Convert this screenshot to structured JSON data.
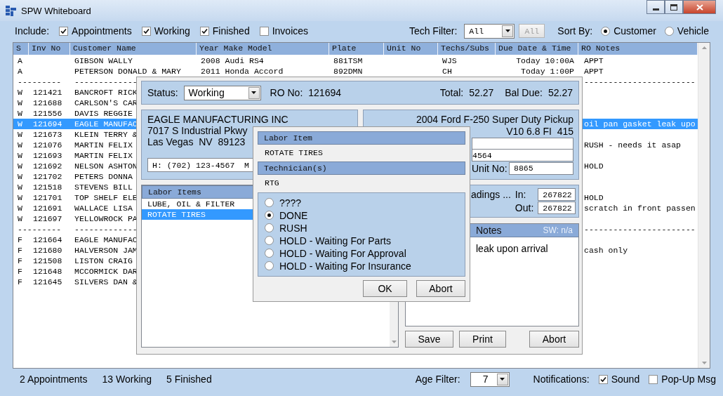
{
  "window": {
    "title": "SPW Whiteboard"
  },
  "toolbar": {
    "include_label": "Include:",
    "include": [
      {
        "label": "Appointments",
        "checked": true
      },
      {
        "label": "Working",
        "checked": true
      },
      {
        "label": "Finished",
        "checked": true
      },
      {
        "label": "Invoices",
        "checked": false
      }
    ],
    "tech_filter_label": "Tech Filter:",
    "tech_filter_value": "All",
    "tech_filter_button": {
      "label": "All",
      "disabled": true
    },
    "sort_label": "Sort By:",
    "sort_by": [
      {
        "label": "Customer",
        "selected": true
      },
      {
        "label": "Vehicle",
        "selected": false
      }
    ]
  },
  "table": {
    "columns": [
      "S",
      "Inv No",
      "Customer Name",
      "Year Make Model",
      "Plate",
      "Unit No",
      "Techs/Subs",
      "Due Date & Time",
      "RO Notes"
    ],
    "rows": [
      {
        "kind": "record",
        "selected": false,
        "s": "A",
        "customer": "GIBSON WALLY",
        "year_make_model": "2008 Audi RS4",
        "plate": "881TSM",
        "techs": "WJS",
        "due": "Today 10:00A",
        "notes": "APPT"
      },
      {
        "kind": "record",
        "selected": false,
        "s": "A",
        "customer": "PETERSON DONALD & MARY",
        "year_make_model": "2011 Honda Accord",
        "plate": "892DMN",
        "techs": "CH",
        "due": "Today 1:00P",
        "notes": "APPT"
      },
      {
        "kind": "separator",
        "selected": false,
        "s": "---------",
        "customer": "-------------",
        "notes": "-----------------------"
      },
      {
        "kind": "record",
        "selected": false,
        "s": "W",
        "inv_no": "121421",
        "customer": "BANCROFT RICK"
      },
      {
        "kind": "record",
        "selected": false,
        "s": "W",
        "inv_no": "121688",
        "customer": "CARLSON'S CAR"
      },
      {
        "kind": "record",
        "selected": false,
        "s": "W",
        "inv_no": "121556",
        "customer": "DAVIS REGGIE"
      },
      {
        "kind": "record",
        "selected": true,
        "s": "W",
        "inv_no": "121694",
        "customer": "EAGLE MANUFAC",
        "notes": "oil pan gasket leak upo"
      },
      {
        "kind": "record",
        "selected": false,
        "s": "W",
        "inv_no": "121673",
        "customer": "KLEIN TERRY &"
      },
      {
        "kind": "record",
        "selected": false,
        "s": "W",
        "inv_no": "121076",
        "customer": "MARTIN FELIX",
        "notes": "RUSH - needs it asap"
      },
      {
        "kind": "record",
        "selected": false,
        "s": "W",
        "inv_no": "121693",
        "customer": "MARTIN FELIX"
      },
      {
        "kind": "record",
        "selected": false,
        "s": "W",
        "inv_no": "121692",
        "customer": "NELSON ASHTON",
        "notes": "HOLD"
      },
      {
        "kind": "record",
        "selected": false,
        "s": "W",
        "inv_no": "121702",
        "customer": "PETERS DONNA"
      },
      {
        "kind": "record",
        "selected": false,
        "s": "W",
        "inv_no": "121518",
        "customer": "STEVENS BILL"
      },
      {
        "kind": "record",
        "selected": false,
        "s": "W",
        "inv_no": "121701",
        "customer": "TOP SHELF ELE",
        "notes": "HOLD"
      },
      {
        "kind": "record",
        "selected": false,
        "s": "W",
        "inv_no": "121691",
        "customer": "WALLACE LISA",
        "notes": "scratch in front passen"
      },
      {
        "kind": "record",
        "selected": false,
        "s": "W",
        "inv_no": "121697",
        "customer": "YELLOWROCK PA"
      },
      {
        "kind": "separator",
        "selected": false,
        "s": "---------",
        "customer": "-------------",
        "notes": "-----------------------"
      },
      {
        "kind": "record",
        "selected": false,
        "s": "F",
        "inv_no": "121664",
        "customer": "EAGLE MANUFAC"
      },
      {
        "kind": "record",
        "selected": false,
        "s": "F",
        "inv_no": "121680",
        "customer": "HALVERSON JAM",
        "notes": "cash only"
      },
      {
        "kind": "record",
        "selected": false,
        "s": "F",
        "inv_no": "121508",
        "customer": "LISTON CRAIG"
      },
      {
        "kind": "record",
        "selected": false,
        "s": "F",
        "inv_no": "121648",
        "customer": "MCCORMICK DAR"
      },
      {
        "kind": "record",
        "selected": false,
        "s": "F",
        "inv_no": "121645",
        "customer": "SILVERS DAN &"
      }
    ]
  },
  "ro_dialog": {
    "status_label": "Status:",
    "status_value": "Working",
    "ro_no_label": "RO No:",
    "ro_no": "121694",
    "total_label": "Total:",
    "total": "52.27",
    "bal_due_label": "Bal Due:",
    "bal_due": "52.27",
    "customer": {
      "name": "EAGLE MANUFACTURING INC",
      "address_lines": [
        "7017 S Industrial Pkwy",
        "Las Vegas  NV  89123"
      ],
      "phone": "H: (702) 123-4567  M"
    },
    "vehicle": {
      "description": "2004 Ford F-250 Super Duty Pickup",
      "engine": "V10 6.8 FI  415",
      "field_2": "4564",
      "unit_no_label": "Unit No:",
      "unit_no": "8865"
    },
    "odometer": {
      "label": "adings ...",
      "in_label": "In:",
      "in": "267822",
      "out_label": "Out:",
      "out": "267822"
    },
    "notes": {
      "title": "Notes",
      "sw": "SW: n/a",
      "text": "leak upon arrival"
    },
    "labor_items": {
      "title": "Labor Items",
      "items": [
        {
          "label": "LUBE, OIL & FILTER",
          "selected": false
        },
        {
          "label": "ROTATE TIRES",
          "selected": true
        }
      ]
    },
    "buttons": [
      "Save",
      "Print",
      "Abort"
    ]
  },
  "labor_dialog": {
    "labor_item_title": "Labor Item",
    "labor_item": "ROTATE TIRES",
    "technicians_title": "Technician(s)",
    "technicians": "RTG",
    "statuses": [
      {
        "label": "????",
        "selected": false
      },
      {
        "label": "DONE",
        "selected": true
      },
      {
        "label": "RUSH",
        "selected": false
      },
      {
        "label": "HOLD - Waiting For Parts",
        "selected": false
      },
      {
        "label": "HOLD - Waiting For Approval",
        "selected": false
      },
      {
        "label": "HOLD - Waiting For Insurance",
        "selected": false
      }
    ],
    "buttons": [
      "OK",
      "Abort"
    ]
  },
  "status_bar": {
    "counts": [
      "2 Appointments",
      "13 Working",
      "5 Finished"
    ],
    "age_filter_label": "Age Filter:",
    "age_filter_value": "7",
    "notifications_label": "Notifications:",
    "notifications": [
      {
        "label": "Sound",
        "checked": true
      },
      {
        "label": "Pop-Up Msg",
        "checked": false
      }
    ]
  }
}
